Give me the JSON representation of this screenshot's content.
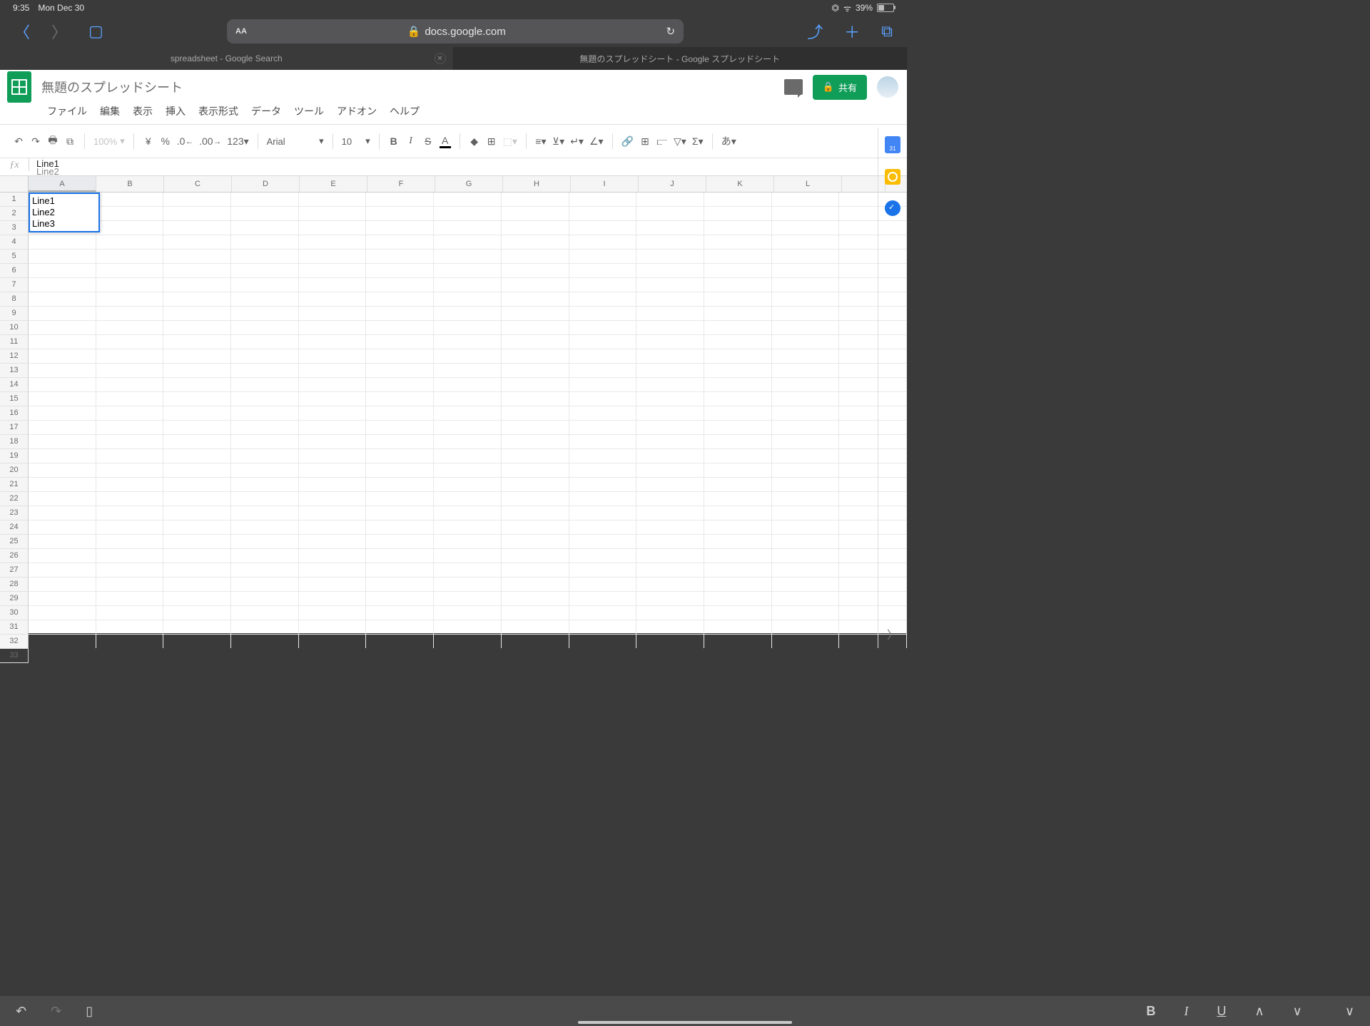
{
  "status": {
    "time": "9:35",
    "date": "Mon Dec 30",
    "battery_pct": "39%",
    "battery_fill": 39
  },
  "safari": {
    "url_host": "docs.google.com",
    "aa": "AA",
    "tabs": [
      {
        "label": "spreadsheet - Google Search"
      },
      {
        "label": "無題のスプレッドシート - Google スプレッドシート"
      }
    ]
  },
  "sheets": {
    "doc_title": "無題のスプレッドシート",
    "menus": [
      "ファイル",
      "編集",
      "表示",
      "挿入",
      "表示形式",
      "データ",
      "ツール",
      "アドオン",
      "ヘルプ"
    ],
    "share_label": "共有",
    "toolbar": {
      "zoom": "100%",
      "currency": "¥",
      "percent": "%",
      "dec_less": ".0",
      "dec_more": ".00",
      "more_fmt": "123",
      "font": "Arial",
      "font_size": "10",
      "ime": "あ"
    },
    "formula_bar": {
      "line1": "Line1",
      "line2": "Line2"
    },
    "columns": [
      "A",
      "B",
      "C",
      "D",
      "E",
      "F",
      "G",
      "H",
      "I",
      "J",
      "K",
      "L"
    ],
    "rows": 33,
    "active_cell_lines": [
      "Line1",
      "Line2",
      "Line3"
    ],
    "side_calendar_day": "31"
  }
}
